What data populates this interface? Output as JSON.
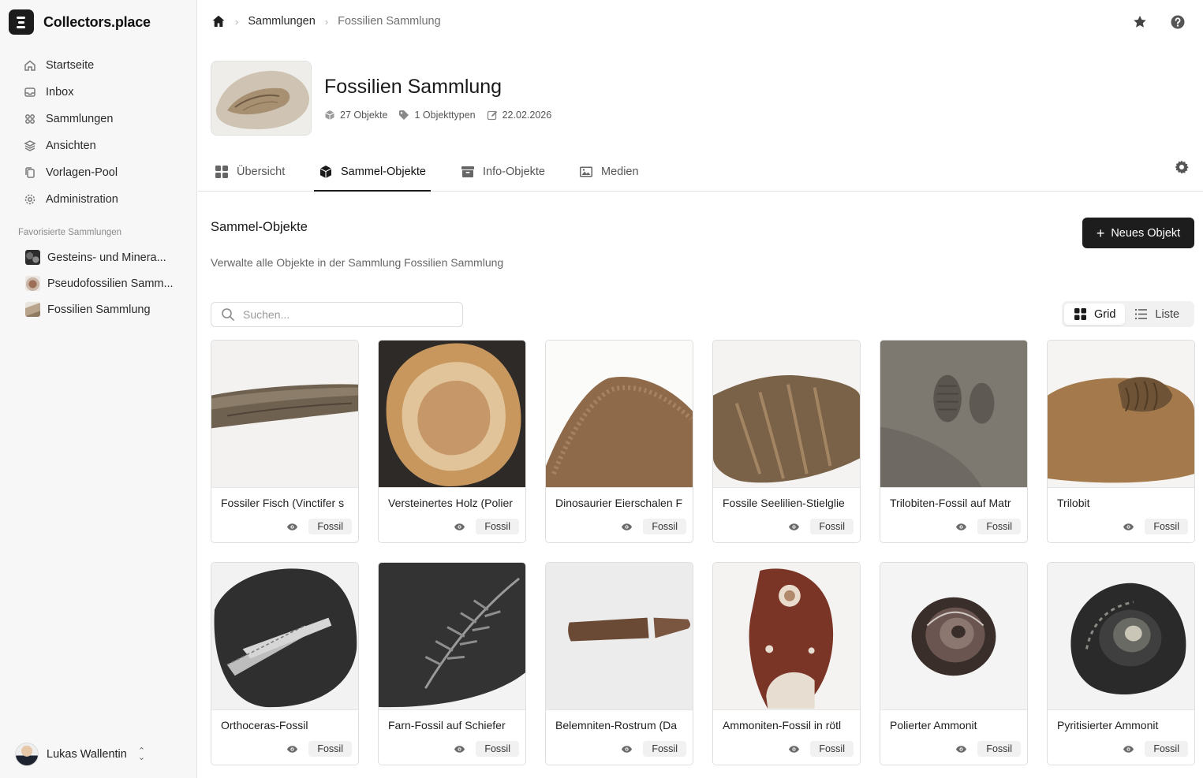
{
  "app": {
    "name": "Collectors.place"
  },
  "sidebar": {
    "nav": [
      {
        "label": "Startseite",
        "icon": "home-icon"
      },
      {
        "label": "Inbox",
        "icon": "inbox-icon"
      },
      {
        "label": "Sammlungen",
        "icon": "grid-icon"
      },
      {
        "label": "Ansichten",
        "icon": "layers-icon"
      },
      {
        "label": "Vorlagen-Pool",
        "icon": "copy-icon"
      },
      {
        "label": "Administration",
        "icon": "gear-icon"
      }
    ],
    "favorites_title": "Favorisierte Sammlungen",
    "favorites": [
      {
        "label": "Gesteins- und Minera..."
      },
      {
        "label": "Pseudofossilien Samm..."
      },
      {
        "label": "Fossilien Sammlung"
      }
    ],
    "user": {
      "name": "Lukas Wallentin"
    }
  },
  "breadcrumb": {
    "items": [
      "Sammlungen",
      "Fossilien Sammlung"
    ]
  },
  "collection": {
    "title": "Fossilien Sammlung",
    "objects": "27 Objekte",
    "types": "1 Objekttypen",
    "date": "22.02.2026"
  },
  "tabs": [
    {
      "label": "Übersicht"
    },
    {
      "label": "Sammel-Objekte"
    },
    {
      "label": "Info-Objekte"
    },
    {
      "label": "Medien"
    }
  ],
  "section": {
    "title": "Sammel-Objekte",
    "description": "Verwalte alle Objekte in der Sammlung Fossilien Sammlung",
    "new_button": "Neues Objekt",
    "search_placeholder": "Suchen...",
    "view_grid": "Grid",
    "view_list": "Liste"
  },
  "objects": [
    {
      "title": "Fossiler Fisch (Vinctifer s",
      "type": "Fossil"
    },
    {
      "title": "Versteinertes Holz (Polier",
      "type": "Fossil"
    },
    {
      "title": "Dinosaurier Eierschalen F",
      "type": "Fossil"
    },
    {
      "title": "Fossile Seelilien-Stielglie",
      "type": "Fossil"
    },
    {
      "title": "Trilobiten-Fossil auf Matr",
      "type": "Fossil"
    },
    {
      "title": "Trilobit",
      "type": "Fossil"
    },
    {
      "title": "Orthoceras-Fossil",
      "type": "Fossil"
    },
    {
      "title": "Farn-Fossil auf Schiefer",
      "type": "Fossil"
    },
    {
      "title": "Belemniten-Rostrum (Da",
      "type": "Fossil"
    },
    {
      "title": "Ammoniten-Fossil in rötl",
      "type": "Fossil"
    },
    {
      "title": "Polierter Ammonit",
      "type": "Fossil"
    },
    {
      "title": "Pyritisierter Ammonit",
      "type": "Fossil"
    }
  ]
}
